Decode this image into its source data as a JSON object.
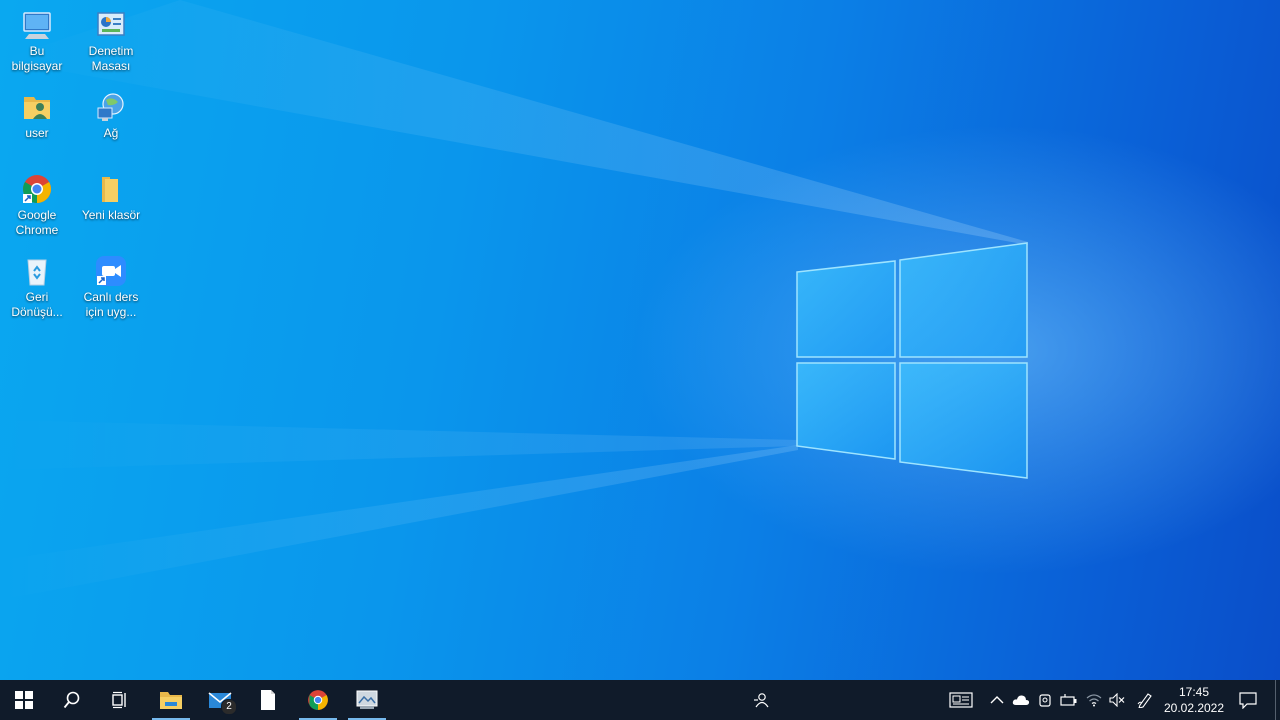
{
  "desktop": {
    "icons": [
      {
        "label": "Bu bilgisayar",
        "icon": "computer-icon"
      },
      {
        "label": "Denetim Masası",
        "icon": "control-panel-icon"
      },
      {
        "label": "user",
        "icon": "user-folder-icon"
      },
      {
        "label": "Ağ",
        "icon": "network-icon"
      },
      {
        "label": "Google Chrome",
        "icon": "chrome-icon"
      },
      {
        "label": "Yeni klasör",
        "icon": "folder-icon"
      },
      {
        "label": "Geri Dönüşü...",
        "icon": "recycle-bin-icon"
      },
      {
        "label": "Canlı ders için uyg...",
        "icon": "video-app-icon"
      }
    ]
  },
  "taskbar": {
    "apps": [
      {
        "name": "start-button",
        "icon": "windows-icon"
      },
      {
        "name": "search-button",
        "icon": "search-icon"
      },
      {
        "name": "task-view-button",
        "icon": "task-view-icon"
      },
      {
        "name": "file-explorer-button",
        "icon": "file-explorer-icon",
        "active": true
      },
      {
        "name": "mail-button",
        "icon": "mail-icon",
        "badge": "2"
      },
      {
        "name": "notepad-button",
        "icon": "document-icon"
      },
      {
        "name": "chrome-taskbar-button",
        "icon": "chrome-icon",
        "active": true
      },
      {
        "name": "photo-app-button",
        "icon": "image-app-icon",
        "active": true
      }
    ],
    "tray": {
      "icons": [
        "people-icon",
        "news-icon",
        "chevron-up-icon",
        "onedrive-icon",
        "meet-now-icon",
        "battery-icon",
        "wifi-icon",
        "volume-muted-icon",
        "pen-icon"
      ],
      "time": "17:45",
      "date": "20.02.2022"
    }
  },
  "colors": {
    "taskbar_bg": "#101b2a",
    "accent_underline": "#76b9ed",
    "wallpaper_blue": "#0a8fea"
  }
}
